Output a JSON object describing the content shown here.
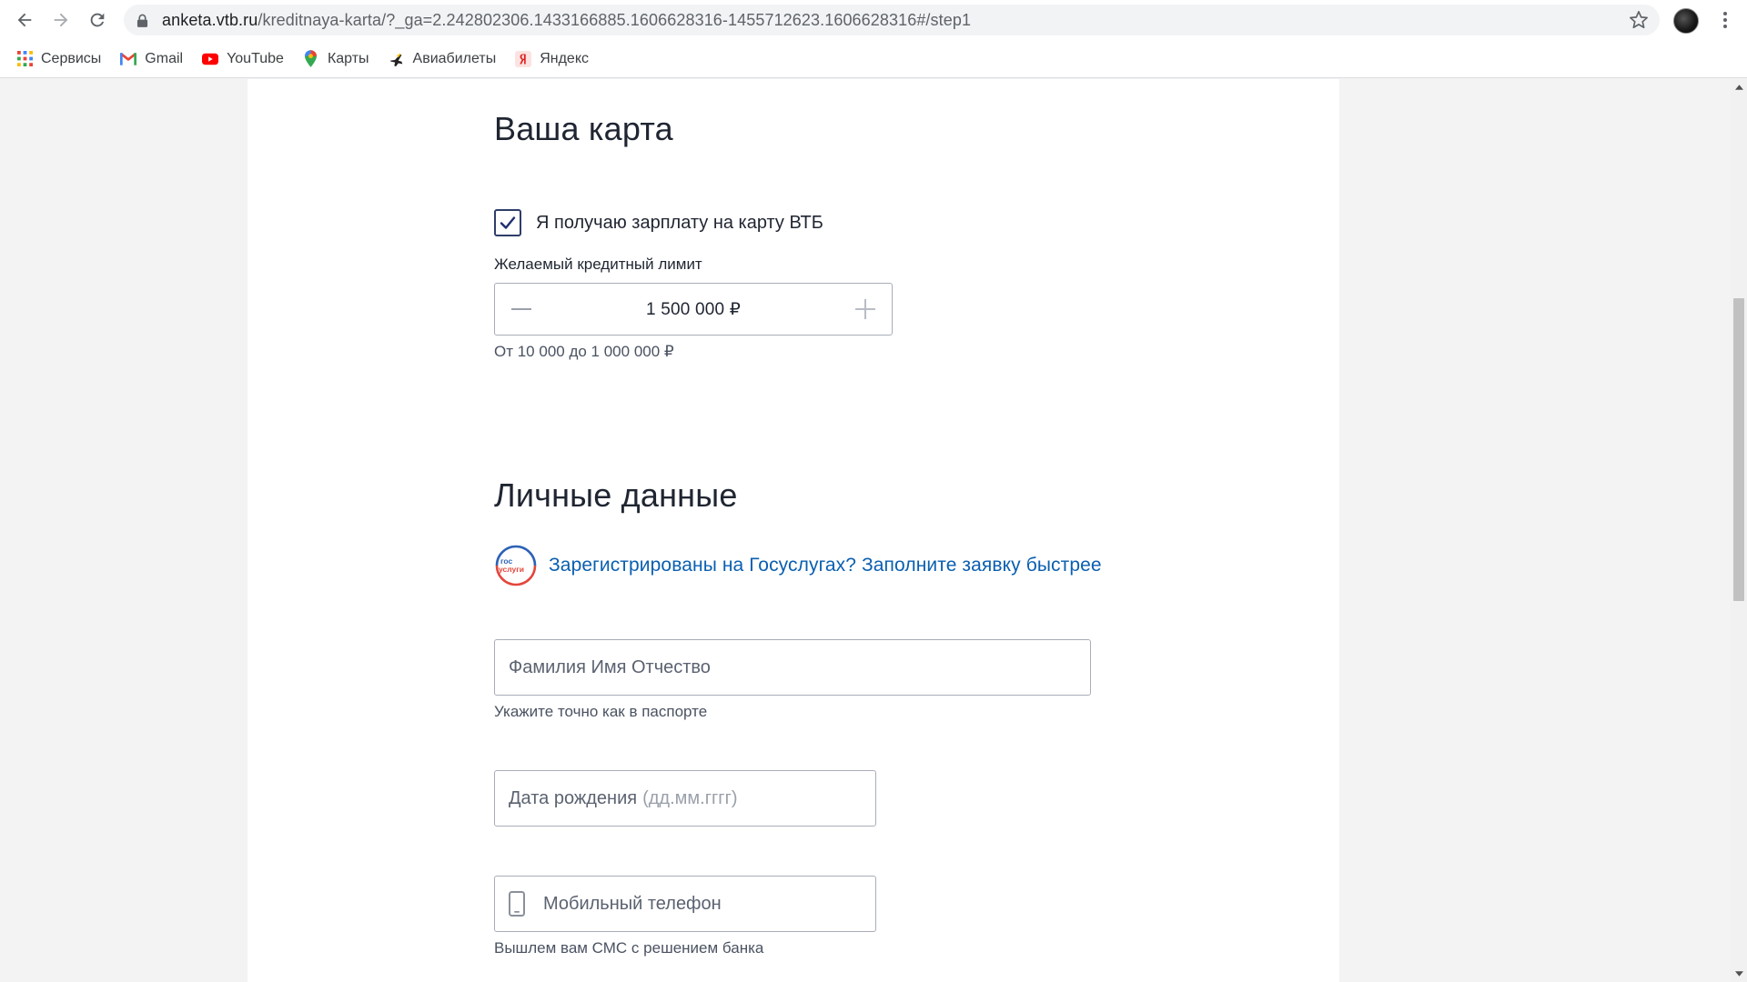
{
  "browser": {
    "url_host": "anketa.vtb.ru",
    "url_path": "/kreditnaya-karta/?_ga=2.242802306.1433166885.1606628316-1455712623.1606628316#/step1",
    "bookmarks": [
      {
        "label": "Сервисы",
        "icon": "apps-grid-icon"
      },
      {
        "label": "Gmail",
        "icon": "gmail-icon"
      },
      {
        "label": "YouTube",
        "icon": "youtube-icon"
      },
      {
        "label": "Карты",
        "icon": "maps-pin-icon"
      },
      {
        "label": "Авиабилеты",
        "icon": "plane-icon"
      },
      {
        "label": "Яндекс",
        "icon": "yandex-icon"
      }
    ]
  },
  "card_section": {
    "title": "Ваша карта",
    "salary_checkbox": {
      "label": "Я получаю зарплату на карту ВТБ",
      "checked": true
    },
    "limit_label": "Желаемый кредитный лимит",
    "limit_value": "1 500 000 ₽",
    "limit_hint": "От 10 000 до 1 000 000 ₽"
  },
  "personal_section": {
    "title": "Личные данные",
    "gosuslugi_link": "Зарегистрированы на Госуслугах? Заполните заявку быстрее",
    "gosuslugi_logo_text": [
      "гос",
      "услуги"
    ],
    "full_name": {
      "placeholder": "Фамилия Имя Отчество",
      "hint": "Укажите точно как в паспорте"
    },
    "birth_date": {
      "placeholder": "Дата рождения",
      "format_hint": "(дд.мм.гггг)"
    },
    "phone": {
      "placeholder": "Мобильный телефон",
      "hint": "Вышлем вам СМС с решением банка"
    }
  },
  "colors": {
    "accent": "#0a5fb0",
    "checkbox": "#2f3d6b",
    "gos_red": "#e4463c",
    "gos_blue": "#2d62b6"
  }
}
